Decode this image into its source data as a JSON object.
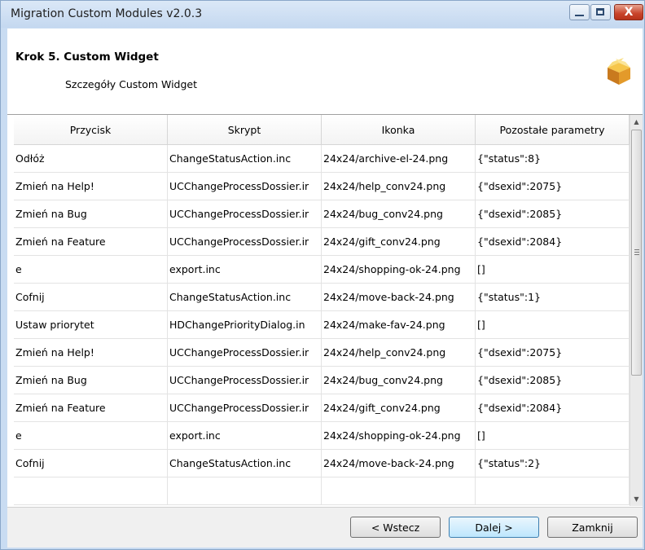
{
  "window": {
    "title": "Migration Custom Modules v2.0.3",
    "close_glyph": "X"
  },
  "header": {
    "step_title": "Krok 5. Custom Widget",
    "step_subtitle": "Szczegóły Custom Widget",
    "icon": "box-icon"
  },
  "grid": {
    "columns": [
      "Przycisk",
      "Skrypt",
      "Ikonka",
      "Pozostałe parametry"
    ],
    "rows": [
      [
        "Odłóż",
        "ChangeStatusAction.inc",
        "24x24/archive-el-24.png",
        "{\"status\":8}"
      ],
      [
        "Zmień na Help!",
        "UCChangeProcessDossier.ir",
        "24x24/help_conv24.png",
        "{\"dsexid\":2075}"
      ],
      [
        "Zmień na Bug",
        "UCChangeProcessDossier.ir",
        "24x24/bug_conv24.png",
        "{\"dsexid\":2085}"
      ],
      [
        "Zmień na Feature",
        "UCChangeProcessDossier.ir",
        "24x24/gift_conv24.png",
        "{\"dsexid\":2084}"
      ],
      [
        "e",
        "export.inc",
        "24x24/shopping-ok-24.png",
        "[]"
      ],
      [
        "Cofnij",
        "ChangeStatusAction.inc",
        "24x24/move-back-24.png",
        "{\"status\":1}"
      ],
      [
        "Ustaw priorytet",
        "HDChangePriorityDialog.in",
        "24x24/make-fav-24.png",
        "[]"
      ],
      [
        "Zmień na Help!",
        "UCChangeProcessDossier.ir",
        "24x24/help_conv24.png",
        "{\"dsexid\":2075}"
      ],
      [
        "Zmień na Bug",
        "UCChangeProcessDossier.ir",
        "24x24/bug_conv24.png",
        "{\"dsexid\":2085}"
      ],
      [
        "Zmień na Feature",
        "UCChangeProcessDossier.ir",
        "24x24/gift_conv24.png",
        "{\"dsexid\":2084}"
      ],
      [
        "e",
        "export.inc",
        "24x24/shopping-ok-24.png",
        "[]"
      ],
      [
        "Cofnij",
        "ChangeStatusAction.inc",
        "24x24/move-back-24.png",
        "{\"status\":2}"
      ],
      [
        "",
        "",
        "",
        ""
      ]
    ]
  },
  "footer": {
    "back_label": "< Wstecz",
    "next_label": "Dalej >",
    "close_label": "Zamknij"
  }
}
